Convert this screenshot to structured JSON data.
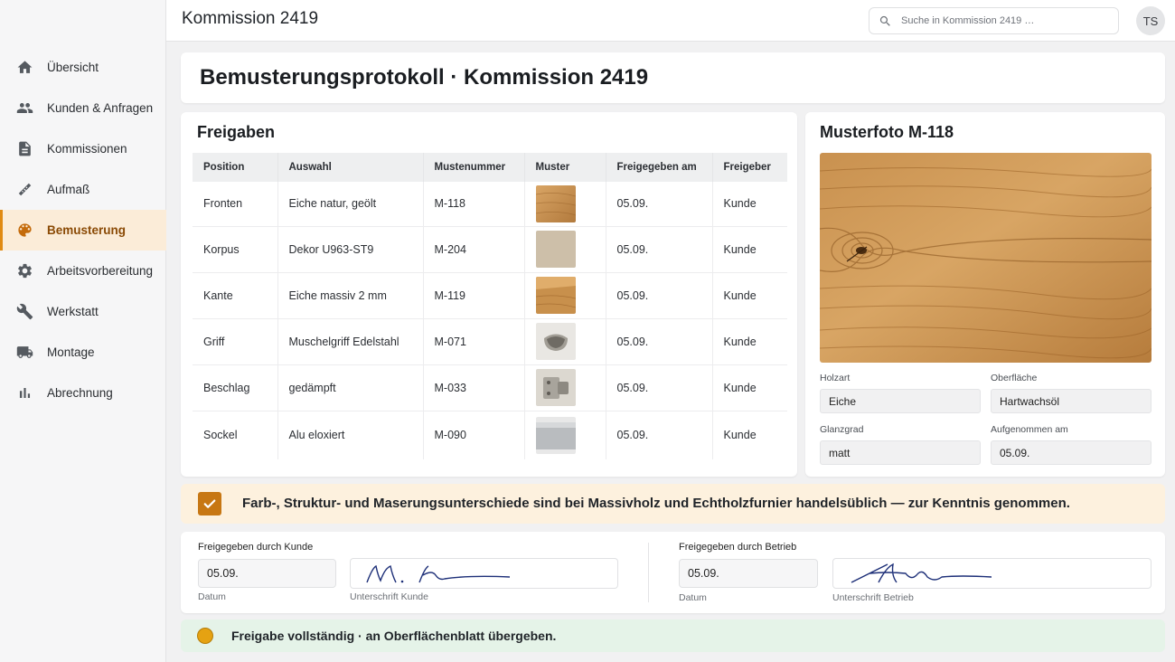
{
  "header": {
    "title": "Kommission 2419",
    "search_placeholder": "Suche in Kommission 2419 …",
    "avatar_initials": "TS"
  },
  "sidebar": {
    "items": [
      {
        "label": "Übersicht",
        "icon": "home-icon"
      },
      {
        "label": "Kunden & Anfragen",
        "icon": "people-icon"
      },
      {
        "label": "Kommissionen",
        "icon": "document-icon"
      },
      {
        "label": "Aufmaß",
        "icon": "ruler-icon"
      },
      {
        "label": "Bemusterung",
        "icon": "palette-icon",
        "active": true
      },
      {
        "label": "Arbeitsvorbereitung",
        "icon": "gear-icon"
      },
      {
        "label": "Werkstatt",
        "icon": "wrench-icon"
      },
      {
        "label": "Montage",
        "icon": "truck-icon"
      },
      {
        "label": "Abrechnung",
        "icon": "bar-chart-icon"
      }
    ]
  },
  "page": {
    "title": "Bemusterungsprotokoll · Kommission 2419"
  },
  "freigaben": {
    "heading": "Freigaben",
    "columns": [
      "Position",
      "Auswahl",
      "Mustenummer",
      "Muster",
      "Freigegeben am",
      "Freigeber"
    ],
    "rows": [
      {
        "position": "Fronten",
        "auswahl": "Eiche natur, geölt",
        "nummer": "M-118",
        "muster": "oak-swatch",
        "datum": "05.09.",
        "freigeber": "Kunde"
      },
      {
        "position": "Korpus",
        "auswahl": "Dekor U963-ST9",
        "nummer": "M-204",
        "muster": "beige-decor-swatch",
        "datum": "05.09.",
        "freigeber": "Kunde"
      },
      {
        "position": "Kante",
        "auswahl": "Eiche massiv 2 mm",
        "nummer": "M-119",
        "muster": "oak-edge-swatch",
        "datum": "05.09.",
        "freigeber": "Kunde"
      },
      {
        "position": "Griff",
        "auswahl": "Muschelgriff Edelstahl",
        "nummer": "M-071",
        "muster": "shell-handle-swatch",
        "datum": "05.09.",
        "freigeber": "Kunde"
      },
      {
        "position": "Beschlag",
        "auswahl": "gedämpft",
        "nummer": "M-033",
        "muster": "hinge-swatch",
        "datum": "05.09.",
        "freigeber": "Kunde"
      },
      {
        "position": "Sockel",
        "auswahl": "Alu eloxiert",
        "nummer": "M-090",
        "muster": "alu-plinth-swatch",
        "datum": "05.09.",
        "freigeber": "Kunde"
      }
    ]
  },
  "musterfoto": {
    "heading": "Musterfoto M-118",
    "fields": {
      "holzart_label": "Holzart",
      "holzart": "Eiche",
      "oberflaeche_label": "Oberfläche",
      "oberflaeche": "Hartwachsöl",
      "glanzgrad_label": "Glanzgrad",
      "glanzgrad": "matt",
      "aufgenommen_label": "Aufgenommen am",
      "aufgenommen": "05.09."
    }
  },
  "notice": {
    "text": "Farb-, Struktur- und Maserungsunterschiede sind bei Massivholz und Echtholzfurnier handelsüblich — zur Kenntnis genommen.",
    "checked": true
  },
  "signatures": {
    "kunde": {
      "heading": "Freigegeben durch Kunde",
      "date": "05.09.",
      "date_label": "Datum",
      "sig_label": "Unterschrift Kunde"
    },
    "betrieb": {
      "heading": "Freigegeben durch Betrieb",
      "date": "05.09.",
      "date_label": "Datum",
      "sig_label": "Unterschrift Betrieb"
    }
  },
  "status": {
    "text": "Freigabe vollständig · an Oberflächenblatt übergeben.",
    "color": "#e5a212"
  }
}
